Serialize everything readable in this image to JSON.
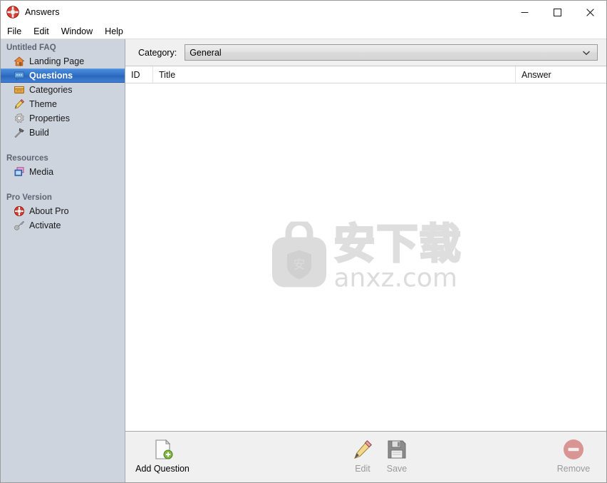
{
  "window": {
    "title": "Answers",
    "app_icon": "lifering-icon",
    "minimize_label": "—",
    "maximize_label": "□",
    "close_label": "✕"
  },
  "menubar": {
    "items": [
      {
        "label": "File",
        "name": "menu-file"
      },
      {
        "label": "Edit",
        "name": "menu-edit"
      },
      {
        "label": "Window",
        "name": "menu-window"
      },
      {
        "label": "Help",
        "name": "menu-help"
      }
    ]
  },
  "sidebar": {
    "groups": [
      {
        "title": "Untitled FAQ",
        "items": [
          {
            "label": "Landing Page",
            "icon": "house-icon",
            "selected": false
          },
          {
            "label": "Questions",
            "icon": "speech-bubble-icon",
            "selected": true
          },
          {
            "label": "Categories",
            "icon": "drawer-icon",
            "selected": false
          },
          {
            "label": "Theme",
            "icon": "pencil-icon",
            "selected": false
          },
          {
            "label": "Properties",
            "icon": "gear-icon",
            "selected": false
          },
          {
            "label": "Build",
            "icon": "hammer-icon",
            "selected": false
          }
        ]
      },
      {
        "title": "Resources",
        "items": [
          {
            "label": "Media",
            "icon": "media-images-icon",
            "selected": false
          }
        ]
      },
      {
        "title": "Pro Version",
        "items": [
          {
            "label": "About Pro",
            "icon": "lifering-icon",
            "selected": false
          },
          {
            "label": "Activate",
            "icon": "key-icon",
            "selected": false
          }
        ]
      }
    ]
  },
  "category_bar": {
    "label": "Category:",
    "selected": "General",
    "options": [
      "General"
    ],
    "arrow_icon": "chevron-down-icon"
  },
  "table": {
    "columns": [
      {
        "key": "id",
        "label": "ID"
      },
      {
        "key": "title",
        "label": "Title"
      },
      {
        "key": "answer",
        "label": "Answer"
      }
    ],
    "rows": []
  },
  "watermark": {
    "logo_icon": "shield-bag-icon",
    "cn_text": "安下载",
    "domain_text": "anxz.com",
    "color": "#dcdcdc"
  },
  "toolbar": {
    "buttons": [
      {
        "label": "Add Question",
        "icon": "document-add-icon",
        "enabled": true
      },
      {
        "label": "Edit",
        "icon": "pencil-icon",
        "enabled": false
      },
      {
        "label": "Save",
        "icon": "floppy-disk-icon",
        "enabled": false
      },
      {
        "label": "Remove",
        "icon": "minus-circle-icon",
        "enabled": false
      }
    ]
  },
  "colors": {
    "sidebar_bg": "#ced4de",
    "selection_blue": "#2f6fc4",
    "toolbar_bg": "#f0f0f0",
    "content_bg": "#ffffff",
    "remove_red": "#d08f8f"
  }
}
